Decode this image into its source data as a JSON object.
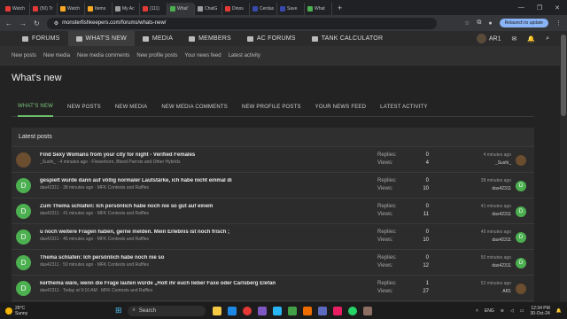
{
  "browser": {
    "tabs": [
      {
        "label": "Watch",
        "color": "#e53935"
      },
      {
        "label": "(50) Tr",
        "color": "#e53935"
      },
      {
        "label": "Watch",
        "color": "#f9a825"
      },
      {
        "label": "Items",
        "color": "#f9a825"
      },
      {
        "label": "My Ac",
        "color": "#9e9e9e"
      },
      {
        "label": "(111) ",
        "color": "#e53935"
      },
      {
        "label": "What'",
        "color": "#4caf50",
        "active": true
      },
      {
        "label": "ChatG",
        "color": "#9e9e9e"
      },
      {
        "label": "Dinos",
        "color": "#e53935"
      },
      {
        "label": "Cerdas",
        "color": "#3949ab"
      },
      {
        "label": "Save ",
        "color": "#3949ab"
      },
      {
        "label": "What ",
        "color": "#4caf50"
      }
    ],
    "new_tab": "+",
    "window_controls": [
      "—",
      "❐",
      "✕"
    ],
    "url": "monsterfishkeepers.com/forums/whats-new/",
    "relaunch_label": "Relaunch to update"
  },
  "nav": {
    "items": [
      {
        "label": "FORUMS"
      },
      {
        "label": "WHAT'S NEW",
        "active": true
      },
      {
        "label": "MEDIA"
      },
      {
        "label": "MEMBERS"
      },
      {
        "label": "AC FORUMS"
      },
      {
        "label": "TANK CALCULATOR"
      }
    ],
    "username": "AR1"
  },
  "subnav": [
    "New posts",
    "New media",
    "New media comments",
    "New profile posts",
    "Your news feed",
    "Latest activity"
  ],
  "page_title": "What's new",
  "tabs": [
    "WHAT'S NEW",
    "NEW POSTS",
    "NEW MEDIA",
    "NEW MEDIA COMMENTS",
    "NEW PROFILE POSTS",
    "YOUR NEWS FEED",
    "LATEST ACTIVITY"
  ],
  "latest_posts": {
    "heading": "Latest posts",
    "replies_label": "Replies:",
    "views_label": "Views:",
    "threads": [
      {
        "title": "Find Sexy Womans from your city for night - Verified Females",
        "author": "_Sushi_",
        "time": "4 minutes ago",
        "forum": "Flowerhorn, Blood Parrots and Other Hybrids",
        "replies": "0",
        "views": "4",
        "last_time": "4 minutes ago",
        "last_user": "_Sushi_",
        "avatar": "img"
      },
      {
        "title": "gespielt wurde dann auf völlig normaler Lautstärke, ich habe nicht einmal di",
        "author": "das42311",
        "time": "38 minutes ago",
        "forum": "MFK Contests and Raffles",
        "replies": "0",
        "views": "10",
        "last_time": "38 minutes ago",
        "last_user": "das42311",
        "avatar": "D"
      },
      {
        "title": "Zum Thema schlafen: Ich persönlich habe noch nie so gut auf einem",
        "author": "das42311",
        "time": "41 minutes ago",
        "forum": "MFK Contests and Raffles",
        "replies": "0",
        "views": "11",
        "last_time": "41 minutes ago",
        "last_user": "das42311",
        "avatar": "D"
      },
      {
        "title": "u noch weitere Fragen haben, gerne melden. Mein Erlebnis ist noch frisch ;",
        "author": "das42311",
        "time": "45 minutes ago",
        "forum": "MFK Contests and Raffles",
        "replies": "0",
        "views": "10",
        "last_time": "45 minutes ago",
        "last_user": "das42311",
        "avatar": "D"
      },
      {
        "title": "Thema schlafen: Ich persönlich habe noch nie so",
        "author": "das42311",
        "time": "50 minutes ago",
        "forum": "MFK Contests and Raffles",
        "replies": "0",
        "views": "12",
        "last_time": "50 minutes ago",
        "last_user": "das42311",
        "avatar": "D"
      },
      {
        "title": "kerthema wäre, wenn die Frage lauten würde „Holt ihr euch lieber Faxe oder Carlsberg Elefan",
        "author": "das42311",
        "time": "Today at 9:16 AM",
        "forum": "MFK Contests and Raffles",
        "replies": "1",
        "views": "27",
        "last_time": "52 minutes ago",
        "last_user": "AR1",
        "avatar": "D",
        "last_avatar": "img"
      }
    ]
  },
  "taskbar": {
    "weather_temp": "26°C",
    "weather_desc": "Sunny",
    "search_placeholder": "Search",
    "lang": "ENG",
    "time": "12:34 PM",
    "date": "30-Oct-24"
  }
}
